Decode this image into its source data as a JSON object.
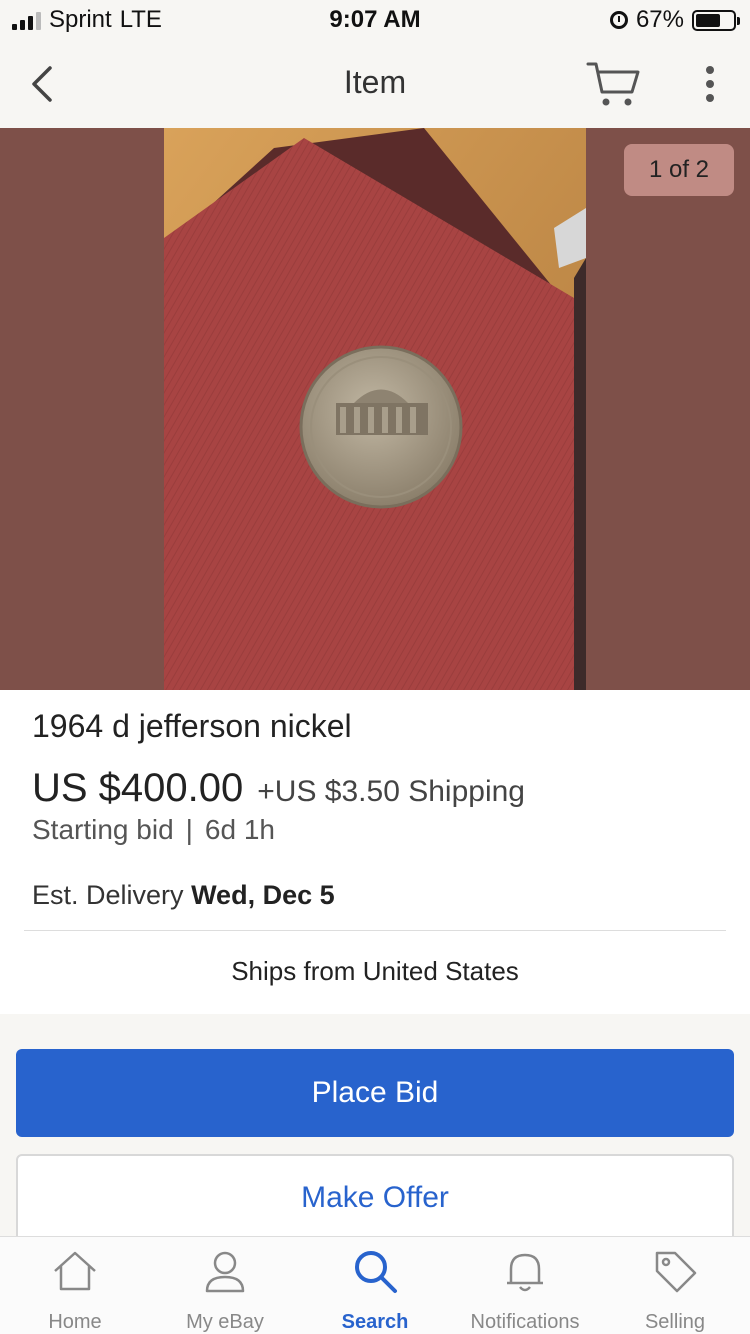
{
  "status_bar": {
    "carrier": "Sprint",
    "network": "LTE",
    "time": "9:07 AM",
    "battery_percent": "67%",
    "battery_level": 0.67
  },
  "nav": {
    "title": "Item",
    "back_icon": "chevron-left-icon",
    "cart_icon": "cart-icon",
    "more_icon": "more-vertical-icon"
  },
  "photo": {
    "counter": "1 of 2"
  },
  "item": {
    "title": "1964 d jefferson nickel",
    "price": "US $400.00",
    "shipping": "+US $3.50 Shipping",
    "bid_type": "Starting bid",
    "separator": "|",
    "time_left": "6d 1h",
    "delivery_label": "Est. Delivery",
    "delivery_date": "Wed, Dec 5",
    "ships_from": "Ships from United States"
  },
  "actions": {
    "place_bid": "Place Bid",
    "make_offer": "Make Offer"
  },
  "tab_bar": {
    "items": [
      {
        "label": "Home",
        "icon": "home-icon"
      },
      {
        "label": "My eBay",
        "icon": "user-icon"
      },
      {
        "label": "Search",
        "icon": "search-icon",
        "active": true
      },
      {
        "label": "Notifications",
        "icon": "bell-icon"
      },
      {
        "label": "Selling",
        "icon": "tag-icon"
      }
    ]
  },
  "colors": {
    "accent": "#2863cd",
    "photo_backdrop": "#7e5049",
    "photo_cloth": "#a84443",
    "nickel": "#a39886"
  }
}
